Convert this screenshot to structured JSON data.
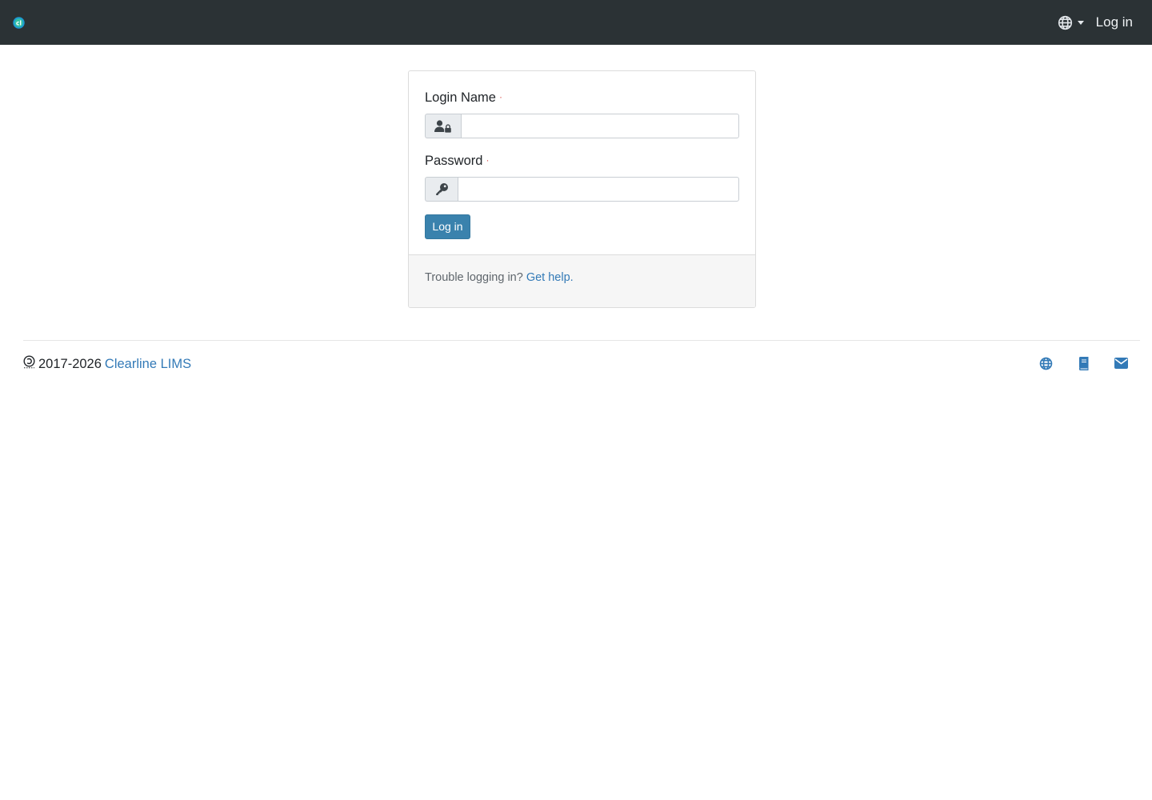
{
  "navbar": {
    "logo_icon": "clearline-logo-icon",
    "language_icon": "globe-icon",
    "login_label": "Log in"
  },
  "form": {
    "login_name_label": "Login Name",
    "login_name_value": "",
    "login_name_icon": "user-lock-icon",
    "password_label": "Password",
    "password_value": "",
    "password_icon": "key-icon",
    "required_marker": "·",
    "submit_label": "Log in"
  },
  "card_footer": {
    "trouble_text": "Trouble logging in?",
    "help_link": "Get help."
  },
  "footer": {
    "copyright_icon": "copyleft-icon",
    "years": "2017-2026",
    "brand": "Clearline LIMS",
    "icons": [
      "globe-icon",
      "book-icon",
      "envelope-icon"
    ]
  },
  "colors": {
    "navbar_bg": "#2b3235",
    "primary": "#3a82ad",
    "link": "#337ab7",
    "required": "#d9534f"
  }
}
